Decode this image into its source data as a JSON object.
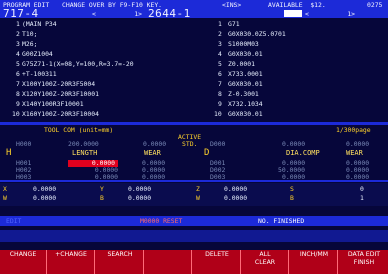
{
  "header": {
    "mode": "PROGRAM EDIT",
    "hint": "CHANGE OVER BY F9-F10 KEY.",
    "ins": "<INS>",
    "available": "AVAILABLE  $12.",
    "counter": "0275",
    "prog_left": "717-4",
    "bracket_left": "<          1>",
    "prog_mid": "2644-1",
    "bracket_right": "<          1>"
  },
  "program_left": [
    {
      "n": "1",
      "code": "(MAIN P34"
    },
    {
      "n": "2",
      "code": "T10;"
    },
    {
      "n": "3",
      "code": "M26;"
    },
    {
      "n": "4",
      "code": "G00Z1004"
    },
    {
      "n": "5",
      "code": "G75Z71-1(X=08,Y=100,R=3.7=-20"
    },
    {
      "n": "6",
      "code": "+T-100311"
    },
    {
      "n": "7",
      "code": "X100Y100Z-20R3F5004"
    },
    {
      "n": "8",
      "code": "X120Y100Z-20R3F10001"
    },
    {
      "n": "9",
      "code": "X140Y100R3F10001"
    },
    {
      "n": "10",
      "code": "X160Y100Z-20R3F10004"
    }
  ],
  "program_right": [
    {
      "n": "1",
      "code": "G71"
    },
    {
      "n": "2",
      "code": "G0X030.0Z5.0701"
    },
    {
      "n": "3",
      "code": "S1000M03"
    },
    {
      "n": "4",
      "code": "G0X030.01"
    },
    {
      "n": "5",
      "code": "Z0.0001"
    },
    {
      "n": "6",
      "code": "X733.0001"
    },
    {
      "n": "7",
      "code": "G0X030.01"
    },
    {
      "n": "8",
      "code": "Z-0.3001"
    },
    {
      "n": "9",
      "code": "X732.1034"
    },
    {
      "n": "10",
      "code": "G0X030.01"
    }
  ],
  "tool_comp": {
    "title": "TOOL COM (unit=mm)",
    "page": "1/300page",
    "active_label": "ACTIVE",
    "std_label": "STD.",
    "top_vals": [
      "H000",
      "200.0000",
      "0.0000",
      "D000",
      "0.0000",
      "0.0000"
    ],
    "h_label": "H",
    "length_label": "LENGTH",
    "wear_label_1": "WEAR",
    "d_label": "D",
    "diacomp_label": "DIA.COMP",
    "wear_label_2": "WEAR",
    "rows": [
      {
        "h": "H001",
        "length": "0.0000",
        "wear": "0.0000",
        "d": "D001",
        "dia": "0.0000",
        "wear2": "0.0000"
      },
      {
        "h": "H002",
        "length": "0.0000",
        "wear": "0.0000",
        "d": "D002",
        "dia": "50.0000",
        "wear2": "0.0000"
      },
      {
        "h": "H003",
        "length": "0.0000",
        "wear": "0.0000",
        "d": "D003",
        "dia": "0.0000",
        "wear2": "0.0000"
      }
    ]
  },
  "positions": {
    "row1": [
      "X",
      "0.0000",
      "Y",
      "0.0000",
      "Z",
      "0.0000",
      "S",
      "0"
    ],
    "row2": [
      "W",
      "0.0000",
      "B",
      "0.0000",
      "W",
      "0.0000",
      "B",
      "1"
    ]
  },
  "status": {
    "mode": "EDIT",
    "message": "M0000 RESET",
    "finished": "NO. FINISHED"
  },
  "softkeys": [
    {
      "line1": "CHANGE",
      "line2": ""
    },
    {
      "line1": "+CHANGE",
      "line2": ""
    },
    {
      "line1": "SEARCH",
      "line2": ""
    },
    {
      "line1": "",
      "line2": ""
    },
    {
      "line1": "DELETE",
      "line2": ""
    },
    {
      "line1": "ALL",
      "line2": "CLEAR"
    },
    {
      "line1": "INCH/MM",
      "line2": ""
    },
    {
      "line1": "DATA EDIT",
      "line2": "FINISH"
    }
  ],
  "colors": {
    "background": "#06063a",
    "header_bar": "#1c2ad8",
    "accent_yellow": "#ffd22a",
    "highlight_red": "#e0001e",
    "softkey_bar": "#b00018"
  }
}
